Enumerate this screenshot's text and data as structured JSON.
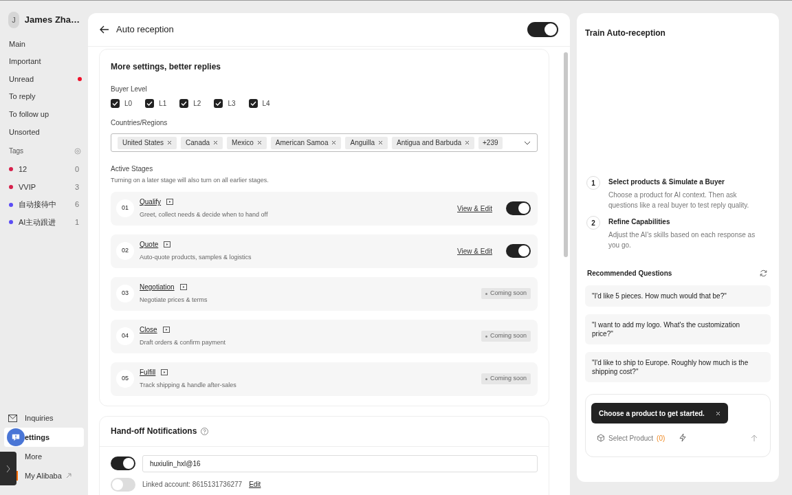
{
  "sidebar": {
    "user": {
      "initial": "J",
      "name": "James Zha…"
    },
    "nav": [
      {
        "label": "Main"
      },
      {
        "label": "Important"
      },
      {
        "label": "Unread",
        "unread_dot": true
      },
      {
        "label": "To reply"
      },
      {
        "label": "To follow up"
      },
      {
        "label": "Unsorted"
      }
    ],
    "tags": {
      "title": "Tags",
      "items": [
        {
          "label": "12",
          "count": "0",
          "color": "#d6204b"
        },
        {
          "label": "VVIP",
          "count": "3",
          "color": "#d6204b"
        },
        {
          "label": "自动接待中",
          "count": "6",
          "color": "#5b4cf5"
        },
        {
          "label": "AI主动跟进",
          "count": "1",
          "color": "#5b4cf5"
        }
      ]
    },
    "bottom": [
      {
        "kind": "mail",
        "label": "Inquiries",
        "selected": false
      },
      {
        "kind": "settings",
        "label": "ettings",
        "selected": true
      },
      {
        "kind": "more",
        "label": "More",
        "selected": false
      },
      {
        "kind": "external",
        "label": "My Alibaba",
        "selected": false
      }
    ]
  },
  "main": {
    "title": "Auto reception",
    "enabled": true,
    "settings": {
      "title": "More settings, better replies",
      "buyer_level": {
        "label": "Buyer Level",
        "options": [
          {
            "label": "L0",
            "checked": true
          },
          {
            "label": "L1",
            "checked": true
          },
          {
            "label": "L2",
            "checked": true
          },
          {
            "label": "L3",
            "checked": true
          },
          {
            "label": "L4",
            "checked": true
          }
        ]
      },
      "countries": {
        "label": "Countries/Regions",
        "tags": [
          "United States",
          "Canada",
          "Mexico",
          "American Samoa",
          "Anguilla",
          "Antigua and Barbuda"
        ],
        "more": "+239"
      },
      "stages": {
        "label": "Active Stages",
        "hint": "Turning on a later stage will also turn on all earlier stages.",
        "items": [
          {
            "number": "01",
            "name": "Qualify",
            "desc": "Greet, collect needs & decide when to hand off",
            "kind": "toggle",
            "link": "View & Edit",
            "on": true
          },
          {
            "number": "02",
            "name": "Quote",
            "desc": "Auto-quote products, samples & logistics",
            "kind": "toggle",
            "link": "View & Edit",
            "on": true
          },
          {
            "number": "03",
            "name": "Negotiation",
            "desc": "Negotiate prices & terms",
            "kind": "soon",
            "badge": "Coming soon"
          },
          {
            "number": "04",
            "name": "Close",
            "desc": "Draft orders & confirm payment",
            "kind": "soon",
            "badge": "Coming soon"
          },
          {
            "number": "05",
            "name": "Fulfill",
            "desc": "Track shipping & handle after-sales",
            "kind": "soon",
            "badge": "Coming soon"
          }
        ]
      }
    },
    "handoff": {
      "title": "Hand-off Notifications",
      "rows": [
        {
          "kind": "email",
          "on": true,
          "value": "huxiulin_hxl@16"
        },
        {
          "kind": "linked",
          "on": false,
          "text": "Linked account: 8615131736277",
          "link": "Edit"
        }
      ]
    }
  },
  "right": {
    "title": "Train Auto-reception",
    "steps": [
      {
        "number": "1",
        "title": "Select products & Simulate a Buyer",
        "desc": "Choose a product for AI context. Then ask questions like a real buyer to test reply quality."
      },
      {
        "number": "2",
        "title": "Refine Capabilities",
        "desc": "Adjust the AI's skills based on each response as you go."
      }
    ],
    "recommended": {
      "title": "Recommended Questions",
      "questions": [
        "\"I'd like 5 pieces. How much would that be?\"",
        "\"I want to add my logo. What's the customization price?\"",
        "\"I'd like to ship to Europe. Roughly how much is the shipping cost?\""
      ]
    },
    "composer": {
      "tooltip": "Choose a product to get started.",
      "product_label": "Select Product",
      "product_count": "(0)"
    }
  }
}
